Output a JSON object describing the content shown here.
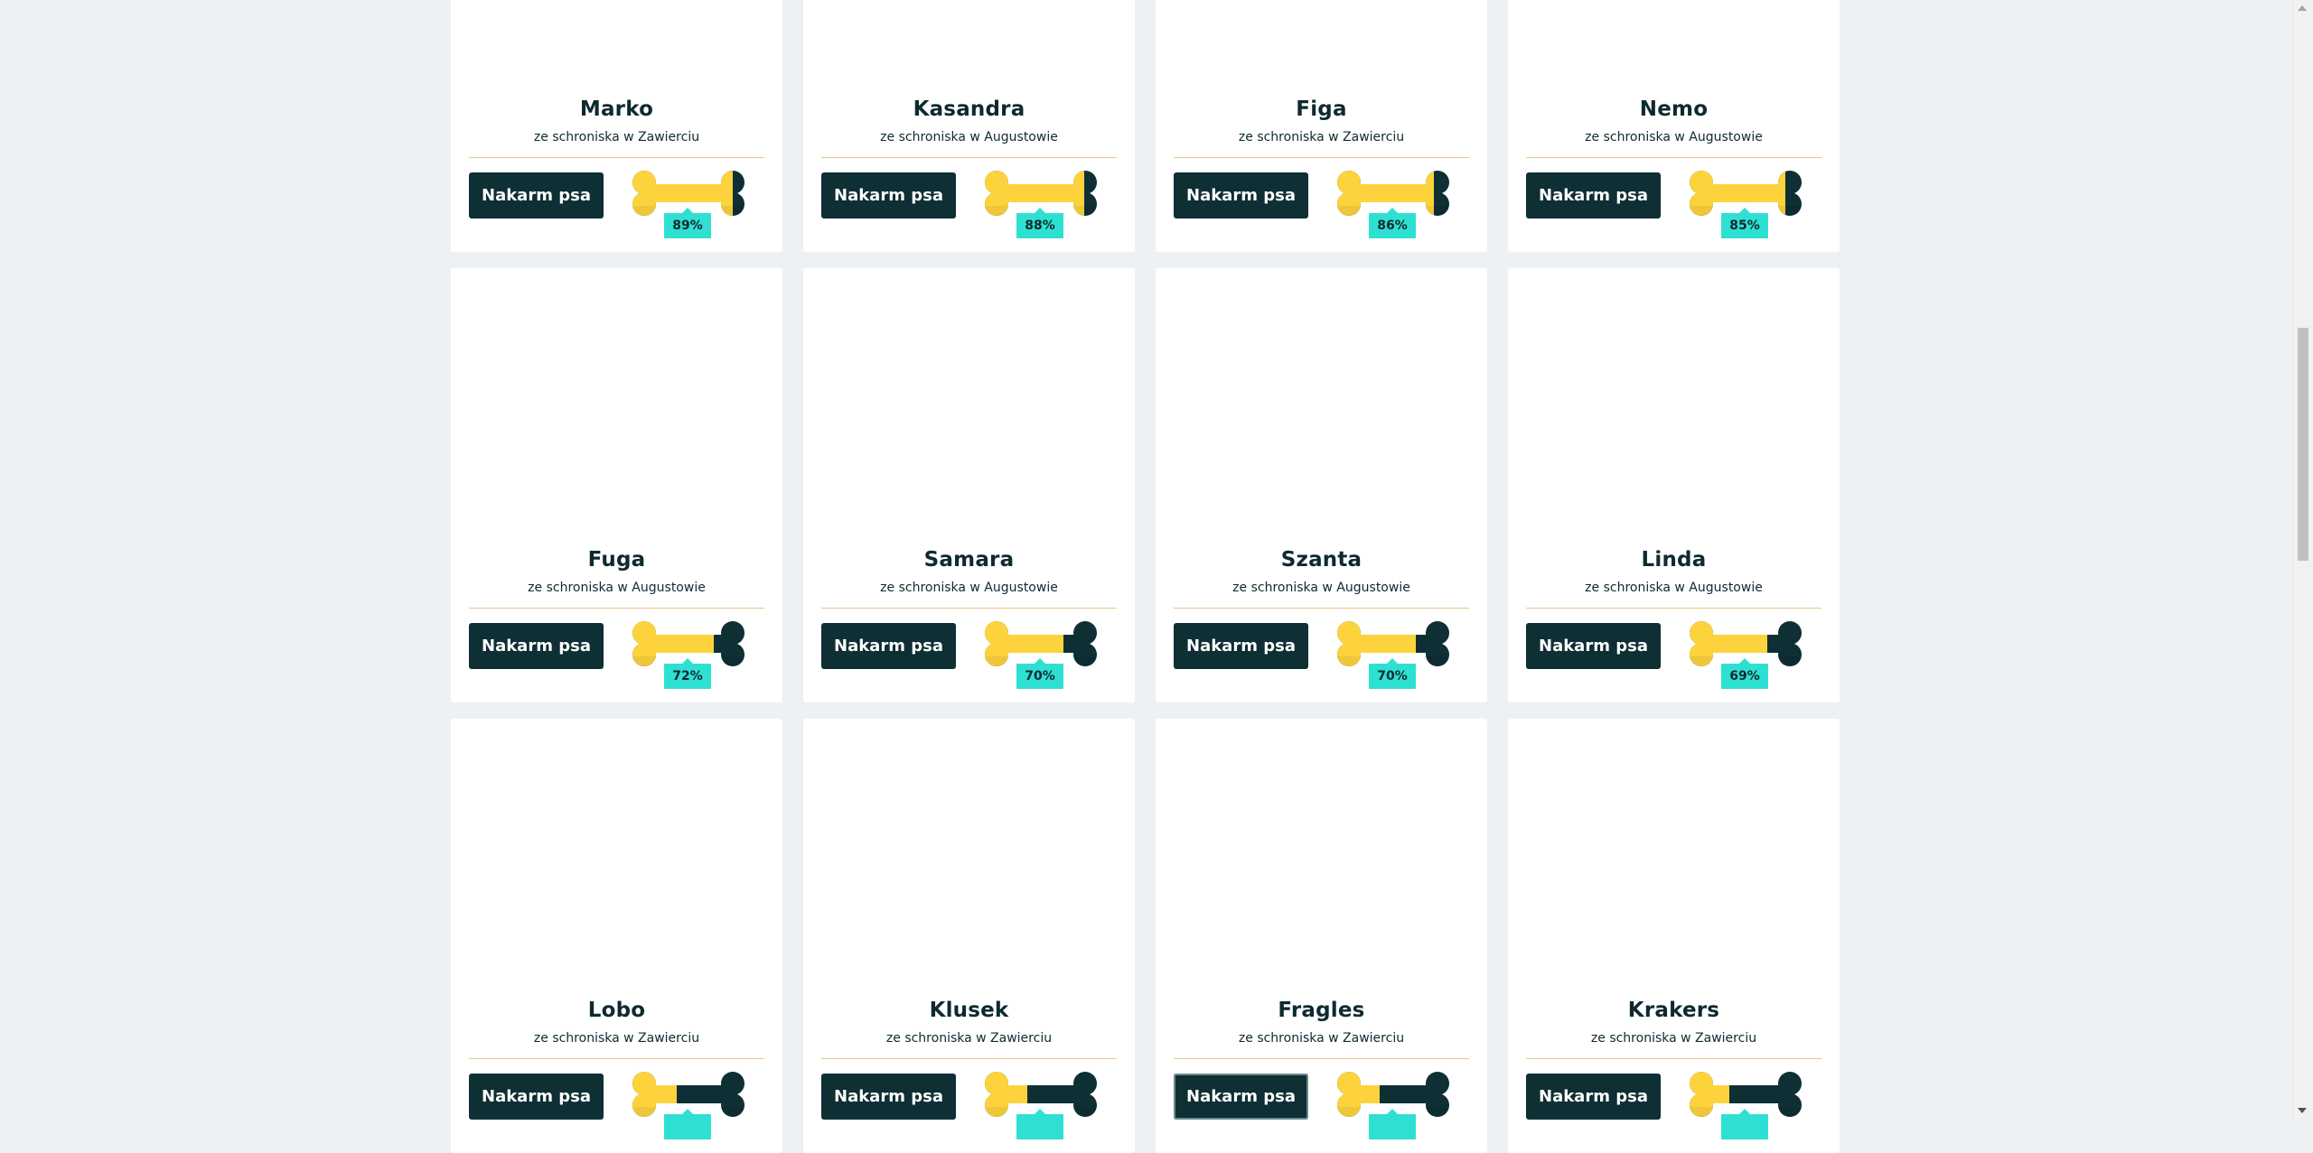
{
  "colors": {
    "background": "#eef1f3",
    "card": "#ffffff",
    "button": "#0e2f34",
    "bone_fill": "#fdd33d",
    "bone_empty": "#0e2f34",
    "percent_badge": "#2ee0d2",
    "divider": "#e8c68a"
  },
  "button_label": "Nakarm psa",
  "dogs": [
    {
      "name": "Marko",
      "shelter": "ze schroniska w Zawierciu",
      "fed_percent": "89%",
      "fed": 0.89
    },
    {
      "name": "Kasandra",
      "shelter": "ze schroniska w Augustowie",
      "fed_percent": "88%",
      "fed": 0.88
    },
    {
      "name": "Figa",
      "shelter": "ze schroniska w Zawierciu",
      "fed_percent": "86%",
      "fed": 0.86
    },
    {
      "name": "Nemo",
      "shelter": "ze schroniska w Augustowie",
      "fed_percent": "85%",
      "fed": 0.85
    },
    {
      "name": "Fuga",
      "shelter": "ze schroniska w Augustowie",
      "fed_percent": "72%",
      "fed": 0.72
    },
    {
      "name": "Samara",
      "shelter": "ze schroniska w Augustowie",
      "fed_percent": "70%",
      "fed": 0.7
    },
    {
      "name": "Szanta",
      "shelter": "ze schroniska w Augustowie",
      "fed_percent": "70%",
      "fed": 0.7
    },
    {
      "name": "Linda",
      "shelter": "ze schroniska w Augustowie",
      "fed_percent": "69%",
      "fed": 0.69
    },
    {
      "name": "Lobo",
      "shelter": "ze schroniska w Zawierciu",
      "fed_percent": "",
      "fed": 0.4
    },
    {
      "name": "Klusek",
      "shelter": "ze schroniska w Zawierciu",
      "fed_percent": "",
      "fed": 0.38
    },
    {
      "name": "Fragles",
      "shelter": "ze schroniska w Zawierciu",
      "fed_percent": "",
      "fed": 0.38
    },
    {
      "name": "Krakers",
      "shelter": "ze schroniska w Zawierciu",
      "fed_percent": "",
      "fed": 0.36
    }
  ]
}
